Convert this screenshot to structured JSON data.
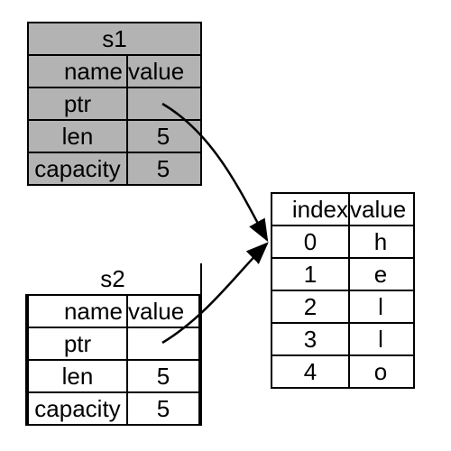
{
  "s1": {
    "title": "s1",
    "headers": {
      "name": "name",
      "value": "value"
    },
    "rows": [
      {
        "name": "ptr",
        "value": ""
      },
      {
        "name": "len",
        "value": "5"
      },
      {
        "name": "capacity",
        "value": "5"
      }
    ],
    "greyed": true
  },
  "s2": {
    "title": "s2",
    "headers": {
      "name": "name",
      "value": "value"
    },
    "rows": [
      {
        "name": "ptr",
        "value": ""
      },
      {
        "name": "len",
        "value": "5"
      },
      {
        "name": "capacity",
        "value": "5"
      }
    ],
    "greyed": false
  },
  "heap": {
    "headers": {
      "index": "index",
      "value": "value"
    },
    "rows": [
      {
        "index": "0",
        "value": "h"
      },
      {
        "index": "1",
        "value": "e"
      },
      {
        "index": "2",
        "value": "l"
      },
      {
        "index": "3",
        "value": "l"
      },
      {
        "index": "4",
        "value": "o"
      }
    ]
  },
  "chart_data": {
    "type": "table",
    "title": "Two String structs (s1 greyed/moved, s2 active) pointing to the same heap buffer \"hello\"",
    "structs": [
      {
        "name": "s1",
        "ptr_points_to": "heap",
        "len": 5,
        "capacity": 5,
        "state": "moved"
      },
      {
        "name": "s2",
        "ptr_points_to": "heap",
        "len": 5,
        "capacity": 5,
        "state": "active"
      }
    ],
    "heap_buffer": [
      {
        "index": 0,
        "value": "h"
      },
      {
        "index": 1,
        "value": "e"
      },
      {
        "index": 2,
        "value": "l"
      },
      {
        "index": 3,
        "value": "l"
      },
      {
        "index": 4,
        "value": "o"
      }
    ]
  }
}
